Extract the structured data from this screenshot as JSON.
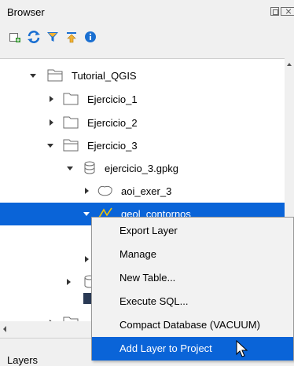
{
  "panel": {
    "title": "Browser",
    "bottom_tab": "Layers"
  },
  "toolbar": [
    {
      "name": "add-selected-layers-icon"
    },
    {
      "name": "refresh-icon"
    },
    {
      "name": "filter-icon"
    },
    {
      "name": "collapse-all-icon"
    },
    {
      "name": "properties-icon"
    }
  ],
  "tree": {
    "tutorial": "Tutorial_QGIS",
    "ej1": "Ejercicio_1",
    "ej2": "Ejercicio_2",
    "ej3": "Ejercicio_3",
    "gpkg": "ejercicio_3.gpkg",
    "aoi": "aoi_exer_3",
    "geol": "geol_contornos"
  },
  "context_menu": {
    "export": "Export Layer",
    "manage": "Manage",
    "new_table": "New Table...",
    "exec_sql": "Execute SQL...",
    "compact": "Compact Database (VACUUM)",
    "add_layer": "Add Layer to Project"
  },
  "colors": {
    "selection": "#0a64d8",
    "accent": "#1a6fd1",
    "add_green": "#3a9a36"
  }
}
